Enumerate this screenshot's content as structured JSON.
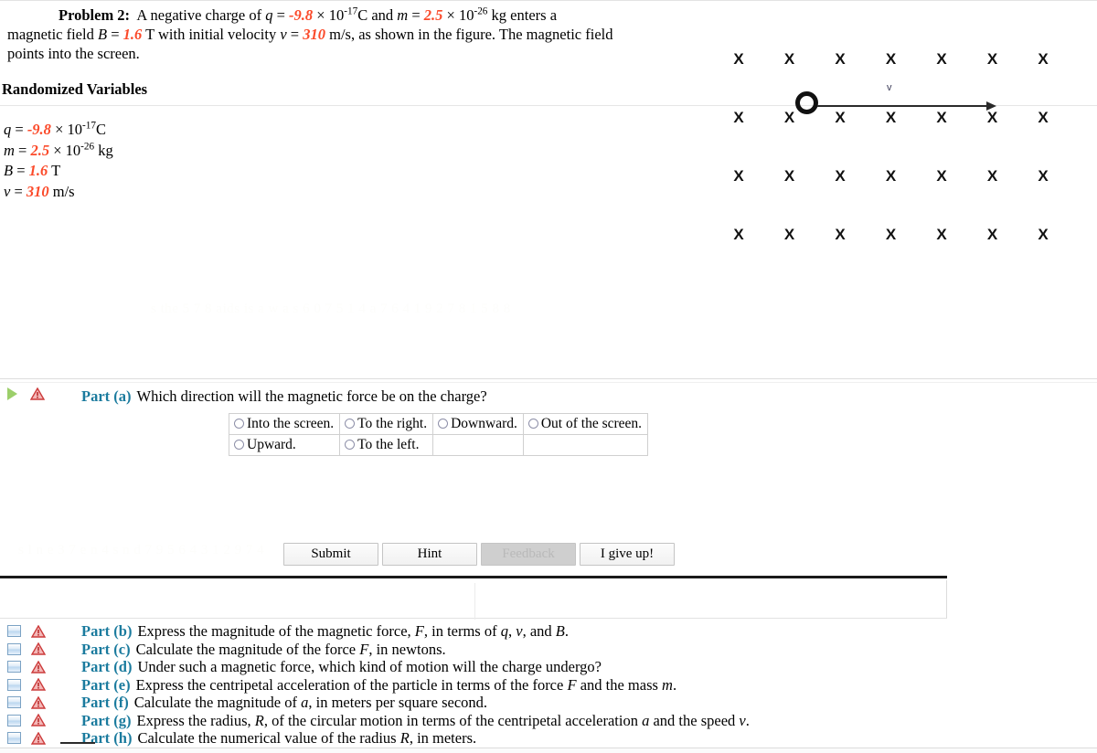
{
  "problem": {
    "label": "Problem 2:",
    "line1_a": "A negative charge of ",
    "q_sym": "q",
    "eq": " = ",
    "q_val": "-9.8",
    "times": " × 10",
    "q_exp": "-17",
    "q_unit": "C and ",
    "m_sym": "m",
    "m_val": "2.5",
    "m_exp": "-26",
    "m_unit": " kg enters a",
    "line2_a": "magnetic field ",
    "B_sym": "B",
    "B_val": "1.6",
    "B_unit": " T with initial velocity ",
    "v_sym": "v",
    "v_val": "310",
    "v_unit": " m/s, as shown in the figure. The magnetic field",
    "line3": "points into the screen."
  },
  "randomized": {
    "heading": "Randomized Variables",
    "rows": [
      {
        "sym": "q",
        "eq": " = ",
        "val": "-9.8",
        "mul": " × 10",
        "exp": "-17",
        "unit": "C"
      },
      {
        "sym": "m",
        "eq": " = ",
        "val": "2.5",
        "mul": " × 10",
        "exp": "-26",
        "unit": " kg"
      },
      {
        "sym": "B",
        "eq": " = ",
        "val": "1.6",
        "mul": "",
        "exp": "",
        "unit": " T"
      },
      {
        "sym": "v",
        "eq": " = ",
        "val": "310",
        "mul": "",
        "exp": "",
        "unit": " m/s"
      }
    ]
  },
  "figure": {
    "x_symbol": "X",
    "columns": 7,
    "rows": 4,
    "velocity_label": "v",
    "charge_marker": "circle-ring"
  },
  "watermarks": [
    "s the 5 7 8 aids is a w a  s 6 0  7 5 1 4 a 7 6 4 1 9 2 7 8   1 5 8 8",
    "s l n e 3 7  e n  4  s n d    7 9 5 6 4   3 1 2  9 7 4"
  ],
  "part_a": {
    "label": "Part (a)",
    "text": "Which direction will the magnetic force be on the charge?",
    "options_rows": [
      [
        "Into the screen.",
        "To the right.",
        "Downward.",
        "Out of the screen."
      ],
      [
        "Upward.",
        "To the left.",
        "",
        ""
      ]
    ]
  },
  "buttons": {
    "submit": "Submit",
    "hint": "Hint",
    "feedback": "Feedback",
    "give_up": "I give up!"
  },
  "parts": [
    {
      "label": "Part (b)",
      "text_html": "Express the magnitude of the magnetic force, <i>F</i>, in terms of <i>q</i>, <i>v</i>, and <i>B</i>.",
      "text": "Express the magnitude of the magnetic force, F, in terms of q, v, and B."
    },
    {
      "label": "Part (c)",
      "text_html": "Calculate the magnitude of the force <i>F</i>, in newtons.",
      "text": "Calculate the magnitude of the force F, in newtons."
    },
    {
      "label": "Part (d)",
      "text_html": "Under such a magnetic force, which kind of motion will the charge undergo?",
      "text": "Under such a magnetic force, which kind of motion will the charge undergo?"
    },
    {
      "label": "Part (e)",
      "text_html": "Express the centripetal acceleration of the particle in terms of the force <i>F</i> and the mass <i>m</i>.",
      "text": "Express the centripetal acceleration of the particle in terms of the force F and the mass m."
    },
    {
      "label": "Part (f)",
      "text_html": "Calculate the magnitude of <i>a</i>, in meters per square second.",
      "text": "Calculate the magnitude of a, in meters per square second."
    },
    {
      "label": "Part (g)",
      "text_html": "Express the radius, <i>R</i>, of the circular motion in terms of the centripetal acceleration <i>a</i> and the speed <i>v</i>.",
      "text": "Express the radius, R, of the circular motion in terms of the centripetal acceleration a and the speed v."
    },
    {
      "label": "Part (h)",
      "text_html": "Calculate the numerical value of the radius <i>R</i>, in meters.",
      "text": "Calculate the numerical value of the radius R, in meters."
    }
  ],
  "colors": {
    "randomized_number": "#fb4a2a",
    "part_label": "#1b7b9e",
    "warning": "#d94040",
    "play": "#9ccf6a"
  }
}
